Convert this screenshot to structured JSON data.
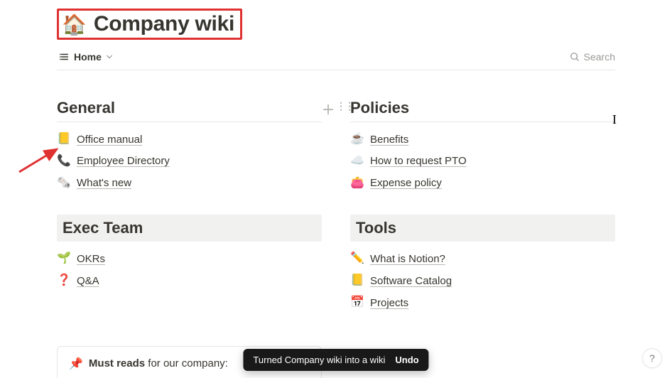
{
  "page": {
    "icon": "🏠",
    "title": "Company wiki"
  },
  "toolbar": {
    "home_label": "Home",
    "search_label": "Search"
  },
  "sections": {
    "general": {
      "heading": "General",
      "items": [
        {
          "icon": "📒",
          "label": "Office manual"
        },
        {
          "icon": "📞",
          "label": "Employee Directory"
        },
        {
          "icon": "🗞️",
          "label": "What's new"
        }
      ]
    },
    "policies": {
      "heading": "Policies",
      "items": [
        {
          "icon": "☕",
          "label": "Benefits"
        },
        {
          "icon": "☁️",
          "label": "How to request PTO"
        },
        {
          "icon": "👛",
          "label": "Expense policy"
        }
      ]
    },
    "exec": {
      "heading": "Exec Team",
      "items": [
        {
          "icon": "🌱",
          "label": "OKRs"
        },
        {
          "icon": "❓",
          "label": "Q&A"
        }
      ]
    },
    "tools": {
      "heading": "Tools",
      "items": [
        {
          "icon": "✏️",
          "label": "What is Notion?"
        },
        {
          "icon": "📒",
          "label": "Software Catalog"
        },
        {
          "icon": "📅",
          "label": "Projects"
        }
      ]
    }
  },
  "must_reads": {
    "icon": "📌",
    "bold": "Must reads",
    "rest": " for our company:"
  },
  "toast": {
    "message": "Turned Company wiki into a wiki",
    "undo_label": "Undo"
  },
  "help": {
    "label": "?"
  },
  "annotations": {
    "highlight_box_color": "#e03131",
    "arrow_color": "#e03131"
  }
}
